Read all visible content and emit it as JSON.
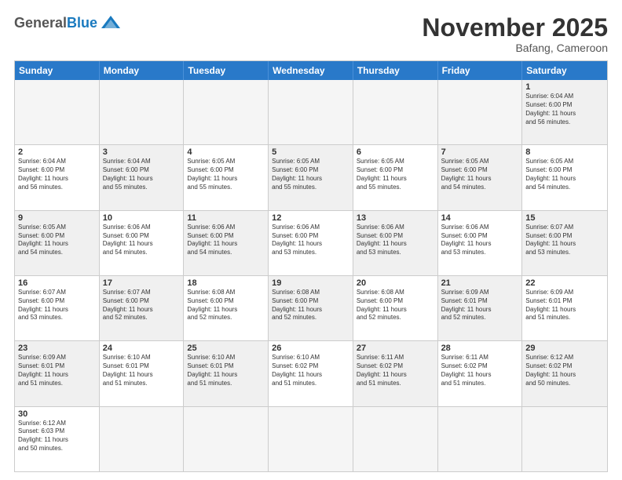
{
  "header": {
    "logo_general": "General",
    "logo_blue": "Blue",
    "month_title": "November 2025",
    "location": "Bafang, Cameroon"
  },
  "weekdays": [
    "Sunday",
    "Monday",
    "Tuesday",
    "Wednesday",
    "Thursday",
    "Friday",
    "Saturday"
  ],
  "rows": [
    [
      {
        "day": "",
        "empty": true,
        "lines": []
      },
      {
        "day": "",
        "empty": true,
        "lines": []
      },
      {
        "day": "",
        "empty": true,
        "lines": []
      },
      {
        "day": "",
        "empty": true,
        "lines": []
      },
      {
        "day": "",
        "empty": true,
        "lines": []
      },
      {
        "day": "",
        "empty": true,
        "lines": []
      },
      {
        "day": "1",
        "empty": false,
        "shaded": true,
        "lines": [
          "Sunrise: 6:04 AM",
          "Sunset: 6:00 PM",
          "Daylight: 11 hours",
          "and 56 minutes."
        ]
      }
    ],
    [
      {
        "day": "2",
        "empty": false,
        "shaded": false,
        "lines": [
          "Sunrise: 6:04 AM",
          "Sunset: 6:00 PM",
          "Daylight: 11 hours",
          "and 56 minutes."
        ]
      },
      {
        "day": "3",
        "empty": false,
        "shaded": true,
        "lines": [
          "Sunrise: 6:04 AM",
          "Sunset: 6:00 PM",
          "Daylight: 11 hours",
          "and 55 minutes."
        ]
      },
      {
        "day": "4",
        "empty": false,
        "shaded": false,
        "lines": [
          "Sunrise: 6:05 AM",
          "Sunset: 6:00 PM",
          "Daylight: 11 hours",
          "and 55 minutes."
        ]
      },
      {
        "day": "5",
        "empty": false,
        "shaded": true,
        "lines": [
          "Sunrise: 6:05 AM",
          "Sunset: 6:00 PM",
          "Daylight: 11 hours",
          "and 55 minutes."
        ]
      },
      {
        "day": "6",
        "empty": false,
        "shaded": false,
        "lines": [
          "Sunrise: 6:05 AM",
          "Sunset: 6:00 PM",
          "Daylight: 11 hours",
          "and 55 minutes."
        ]
      },
      {
        "day": "7",
        "empty": false,
        "shaded": true,
        "lines": [
          "Sunrise: 6:05 AM",
          "Sunset: 6:00 PM",
          "Daylight: 11 hours",
          "and 54 minutes."
        ]
      },
      {
        "day": "8",
        "empty": false,
        "shaded": false,
        "lines": [
          "Sunrise: 6:05 AM",
          "Sunset: 6:00 PM",
          "Daylight: 11 hours",
          "and 54 minutes."
        ]
      }
    ],
    [
      {
        "day": "9",
        "empty": false,
        "shaded": true,
        "lines": [
          "Sunrise: 6:05 AM",
          "Sunset: 6:00 PM",
          "Daylight: 11 hours",
          "and 54 minutes."
        ]
      },
      {
        "day": "10",
        "empty": false,
        "shaded": false,
        "lines": [
          "Sunrise: 6:06 AM",
          "Sunset: 6:00 PM",
          "Daylight: 11 hours",
          "and 54 minutes."
        ]
      },
      {
        "day": "11",
        "empty": false,
        "shaded": true,
        "lines": [
          "Sunrise: 6:06 AM",
          "Sunset: 6:00 PM",
          "Daylight: 11 hours",
          "and 54 minutes."
        ]
      },
      {
        "day": "12",
        "empty": false,
        "shaded": false,
        "lines": [
          "Sunrise: 6:06 AM",
          "Sunset: 6:00 PM",
          "Daylight: 11 hours",
          "and 53 minutes."
        ]
      },
      {
        "day": "13",
        "empty": false,
        "shaded": true,
        "lines": [
          "Sunrise: 6:06 AM",
          "Sunset: 6:00 PM",
          "Daylight: 11 hours",
          "and 53 minutes."
        ]
      },
      {
        "day": "14",
        "empty": false,
        "shaded": false,
        "lines": [
          "Sunrise: 6:06 AM",
          "Sunset: 6:00 PM",
          "Daylight: 11 hours",
          "and 53 minutes."
        ]
      },
      {
        "day": "15",
        "empty": false,
        "shaded": true,
        "lines": [
          "Sunrise: 6:07 AM",
          "Sunset: 6:00 PM",
          "Daylight: 11 hours",
          "and 53 minutes."
        ]
      }
    ],
    [
      {
        "day": "16",
        "empty": false,
        "shaded": false,
        "lines": [
          "Sunrise: 6:07 AM",
          "Sunset: 6:00 PM",
          "Daylight: 11 hours",
          "and 53 minutes."
        ]
      },
      {
        "day": "17",
        "empty": false,
        "shaded": true,
        "lines": [
          "Sunrise: 6:07 AM",
          "Sunset: 6:00 PM",
          "Daylight: 11 hours",
          "and 52 minutes."
        ]
      },
      {
        "day": "18",
        "empty": false,
        "shaded": false,
        "lines": [
          "Sunrise: 6:08 AM",
          "Sunset: 6:00 PM",
          "Daylight: 11 hours",
          "and 52 minutes."
        ]
      },
      {
        "day": "19",
        "empty": false,
        "shaded": true,
        "lines": [
          "Sunrise: 6:08 AM",
          "Sunset: 6:00 PM",
          "Daylight: 11 hours",
          "and 52 minutes."
        ]
      },
      {
        "day": "20",
        "empty": false,
        "shaded": false,
        "lines": [
          "Sunrise: 6:08 AM",
          "Sunset: 6:00 PM",
          "Daylight: 11 hours",
          "and 52 minutes."
        ]
      },
      {
        "day": "21",
        "empty": false,
        "shaded": true,
        "lines": [
          "Sunrise: 6:09 AM",
          "Sunset: 6:01 PM",
          "Daylight: 11 hours",
          "and 52 minutes."
        ]
      },
      {
        "day": "22",
        "empty": false,
        "shaded": false,
        "lines": [
          "Sunrise: 6:09 AM",
          "Sunset: 6:01 PM",
          "Daylight: 11 hours",
          "and 51 minutes."
        ]
      }
    ],
    [
      {
        "day": "23",
        "empty": false,
        "shaded": true,
        "lines": [
          "Sunrise: 6:09 AM",
          "Sunset: 6:01 PM",
          "Daylight: 11 hours",
          "and 51 minutes."
        ]
      },
      {
        "day": "24",
        "empty": false,
        "shaded": false,
        "lines": [
          "Sunrise: 6:10 AM",
          "Sunset: 6:01 PM",
          "Daylight: 11 hours",
          "and 51 minutes."
        ]
      },
      {
        "day": "25",
        "empty": false,
        "shaded": true,
        "lines": [
          "Sunrise: 6:10 AM",
          "Sunset: 6:01 PM",
          "Daylight: 11 hours",
          "and 51 minutes."
        ]
      },
      {
        "day": "26",
        "empty": false,
        "shaded": false,
        "lines": [
          "Sunrise: 6:10 AM",
          "Sunset: 6:02 PM",
          "Daylight: 11 hours",
          "and 51 minutes."
        ]
      },
      {
        "day": "27",
        "empty": false,
        "shaded": true,
        "lines": [
          "Sunrise: 6:11 AM",
          "Sunset: 6:02 PM",
          "Daylight: 11 hours",
          "and 51 minutes."
        ]
      },
      {
        "day": "28",
        "empty": false,
        "shaded": false,
        "lines": [
          "Sunrise: 6:11 AM",
          "Sunset: 6:02 PM",
          "Daylight: 11 hours",
          "and 51 minutes."
        ]
      },
      {
        "day": "29",
        "empty": false,
        "shaded": true,
        "lines": [
          "Sunrise: 6:12 AM",
          "Sunset: 6:02 PM",
          "Daylight: 11 hours",
          "and 50 minutes."
        ]
      }
    ],
    [
      {
        "day": "30",
        "empty": false,
        "shaded": false,
        "lines": [
          "Sunrise: 6:12 AM",
          "Sunset: 6:03 PM",
          "Daylight: 11 hours",
          "and 50 minutes."
        ]
      },
      {
        "day": "",
        "empty": true,
        "lines": []
      },
      {
        "day": "",
        "empty": true,
        "lines": []
      },
      {
        "day": "",
        "empty": true,
        "lines": []
      },
      {
        "day": "",
        "empty": true,
        "lines": []
      },
      {
        "day": "",
        "empty": true,
        "lines": []
      },
      {
        "day": "",
        "empty": true,
        "lines": []
      }
    ]
  ]
}
